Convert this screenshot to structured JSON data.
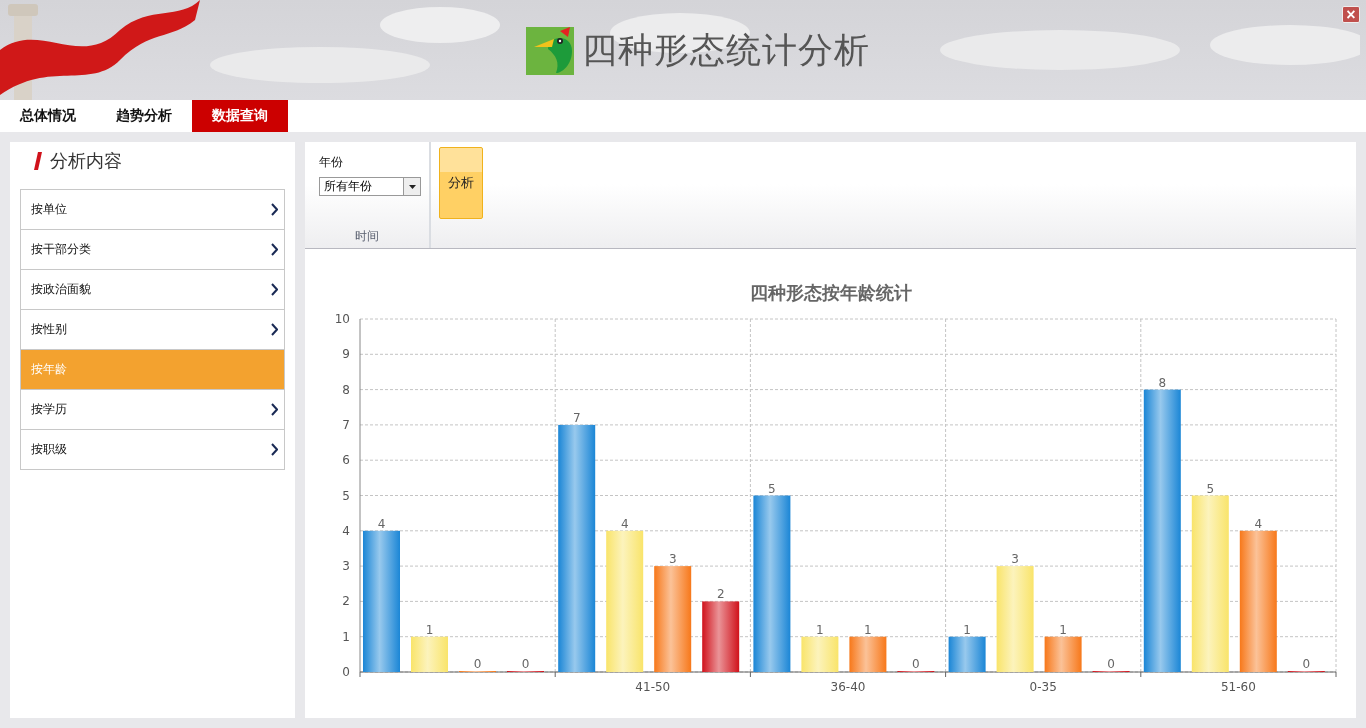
{
  "header": {
    "title": "四种形态统计分析",
    "close": "×"
  },
  "nav_tabs": [
    {
      "label": "总体情况",
      "selected": false
    },
    {
      "label": "趋势分析",
      "selected": false
    },
    {
      "label": "数据查询",
      "selected": true
    }
  ],
  "sidebar": {
    "title": "分析内容",
    "items": [
      {
        "label": "按单位",
        "selected": false
      },
      {
        "label": "按干部分类",
        "selected": false
      },
      {
        "label": "按政治面貌",
        "selected": false
      },
      {
        "label": "按性别",
        "selected": false
      },
      {
        "label": "按年龄",
        "selected": true
      },
      {
        "label": "按学历",
        "selected": false
      },
      {
        "label": "按职级",
        "selected": false
      }
    ]
  },
  "toolbar": {
    "year_label": "年份",
    "year_value": "所有年份",
    "group_label": "时间",
    "analyze_button": "分析"
  },
  "chart_data": {
    "type": "bar",
    "title": "四种形态按年龄统计",
    "categories": [
      null,
      "41-50",
      "36-40",
      "0-35",
      "51-60"
    ],
    "series": [
      {
        "color": "#1b86d6",
        "values": [
          4,
          7,
          5,
          1,
          8
        ]
      },
      {
        "color": "#f9e46a",
        "values": [
          1,
          4,
          1,
          3,
          5
        ]
      },
      {
        "color": "#f7781a",
        "values": [
          0,
          3,
          1,
          1,
          4
        ]
      },
      {
        "color": "#d0121b",
        "values": [
          0,
          2,
          0,
          0,
          0
        ]
      }
    ],
    "ylim": [
      0,
      10
    ],
    "grid": true,
    "yticks": [
      0,
      1,
      2,
      3,
      4,
      5,
      6,
      7,
      8,
      9,
      10
    ],
    "data_labels": true
  }
}
